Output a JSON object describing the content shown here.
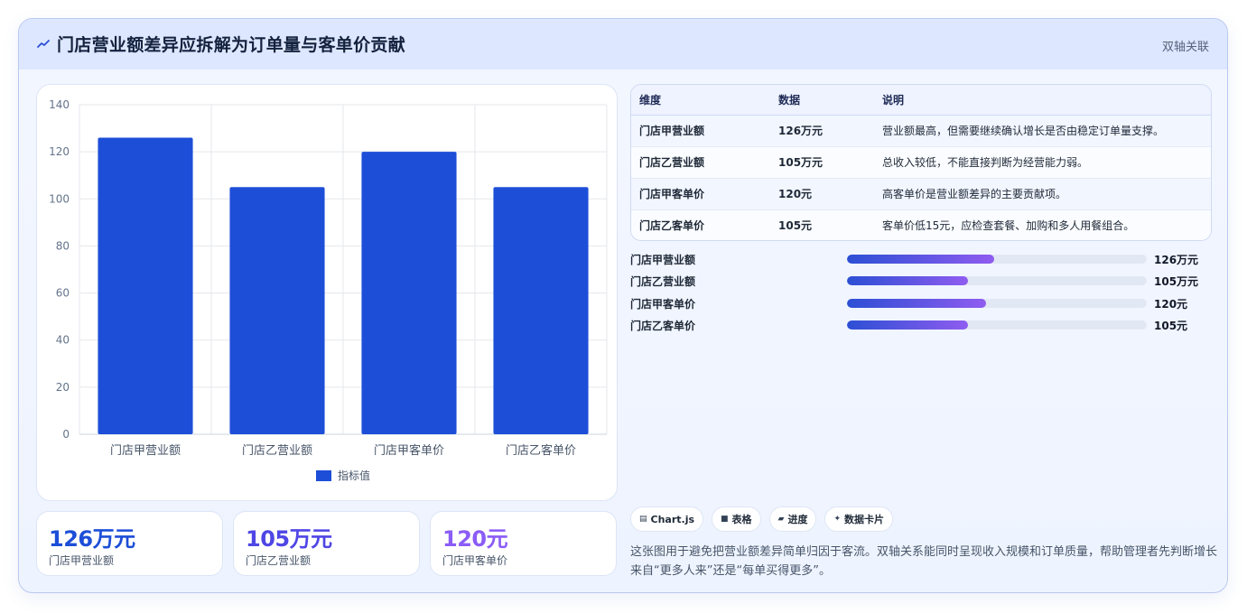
{
  "header": {
    "title": "门店营业额差异应拆解为订单量与客单价贡献",
    "icon": "trend-line-icon",
    "tag": "双轴关联"
  },
  "chart_data": {
    "type": "bar",
    "categories": [
      "门店甲营业额",
      "门店乙营业额",
      "门店甲客单价",
      "门店乙客单价"
    ],
    "series": [
      {
        "name": "指标值",
        "values": [
          126,
          105,
          120,
          105
        ],
        "color": "#1d4ed8"
      }
    ],
    "yticks": [
      0,
      20,
      40,
      60,
      80,
      100,
      120,
      140
    ],
    "ylim": [
      0,
      140
    ],
    "grid": true,
    "legend": "bottom"
  },
  "kpis": [
    {
      "value": "126万元",
      "label": "门店甲营业额",
      "color": "#1d4ed8"
    },
    {
      "value": "105万元",
      "label": "门店乙营业额",
      "color": "#4f46e5"
    },
    {
      "value": "120元",
      "label": "门店甲客单价",
      "color": "#8b5cf6"
    }
  ],
  "table": {
    "headers": [
      "维度",
      "数据",
      "说明"
    ],
    "rows": [
      [
        "门店甲营业额",
        "126万元",
        "营业额最高，但需要继续确认增长是否由稳定订单量支撑。"
      ],
      [
        "门店乙营业额",
        "105万元",
        "总收入较低，不能直接判断为经营能力弱。"
      ],
      [
        "门店甲客单价",
        "120元",
        "高客单价是营业额差异的主要贡献项。"
      ],
      [
        "门店乙客单价",
        "105元",
        "客单价低15元，应检查套餐、加购和多人用餐组合。"
      ]
    ]
  },
  "progress": [
    {
      "label": "门店甲营业额",
      "value": "126万元",
      "fraction": 0.49
    },
    {
      "label": "门店乙营业额",
      "value": "105万元",
      "fraction": 0.405
    },
    {
      "label": "门店甲客单价",
      "value": "120元",
      "fraction": 0.465
    },
    {
      "label": "门店乙客单价",
      "value": "105元",
      "fraction": 0.405
    }
  ],
  "chips": [
    {
      "icon": "chart-icon",
      "glyph": "▤",
      "label": "Chart.js"
    },
    {
      "icon": "table-icon",
      "glyph": "■",
      "label": "表格"
    },
    {
      "icon": "progress-icon",
      "glyph": "▰",
      "label": "进度"
    },
    {
      "icon": "sparkle-icon",
      "glyph": "✦",
      "label": "数据卡片"
    }
  ],
  "description": "这张图用于避免把营业额差异简单归因于客流。双轴关系能同时呈现收入规模和订单质量，帮助管理者先判断增长来自“更多人来”还是“每单买得更多”。"
}
